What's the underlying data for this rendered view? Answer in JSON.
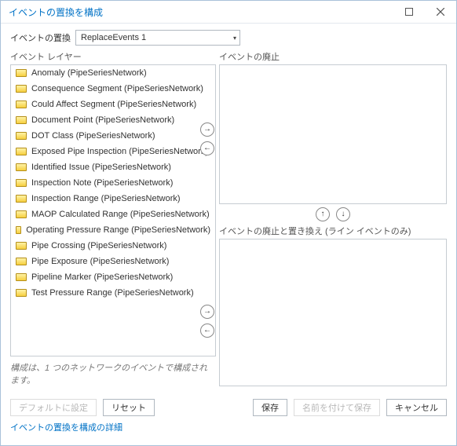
{
  "window": {
    "title": "イベントの置換を構成"
  },
  "fields": {
    "replace_label": "イベントの置換",
    "replace_value": "ReplaceEvents 1"
  },
  "groups": {
    "layers": "イベント レイヤー",
    "retire": "イベントの廃止",
    "retire_replace": "イベントの廃止と置き換え (ライン イベントのみ)"
  },
  "layer_items": [
    "Anomaly (PipeSeriesNetwork)",
    "Consequence Segment (PipeSeriesNetwork)",
    "Could Affect Segment (PipeSeriesNetwork)",
    "Document Point (PipeSeriesNetwork)",
    "DOT Class (PipeSeriesNetwork)",
    "Exposed Pipe Inspection (PipeSeriesNetwork)",
    "Identified Issue (PipeSeriesNetwork)",
    "Inspection Note (PipeSeriesNetwork)",
    "Inspection Range (PipeSeriesNetwork)",
    "MAOP Calculated Range (PipeSeriesNetwork)",
    "Operating Pressure Range (PipeSeriesNetwork)",
    "Pipe Crossing (PipeSeriesNetwork)",
    "Pipe Exposure (PipeSeriesNetwork)",
    "Pipeline Marker (PipeSeriesNetwork)",
    "Test Pressure Range (PipeSeriesNetwork)"
  ],
  "note": "構成は、1 つのネットワークのイベントで構成されます。",
  "buttons": {
    "default": "デフォルトに設定",
    "reset": "リセット",
    "save": "保存",
    "save_as": "名前を付けて保存",
    "cancel": "キャンセル"
  },
  "link": "イベントの置換を構成の詳細"
}
